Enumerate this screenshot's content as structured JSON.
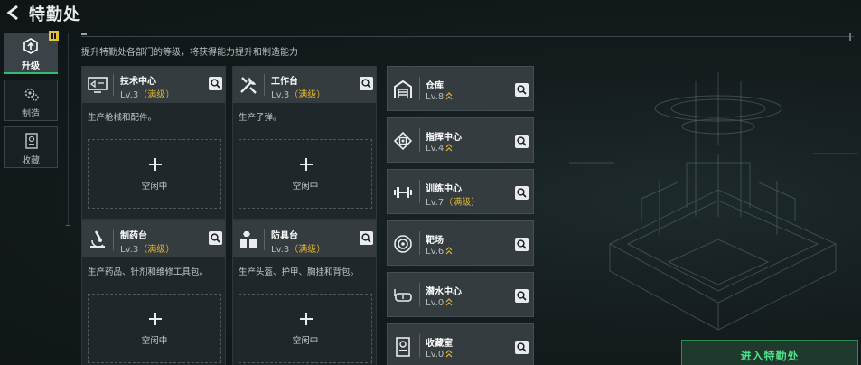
{
  "header": {
    "title": "特勤处"
  },
  "subtitle": "提升特勤处各部门的等级，将获得能力提升和制造能力",
  "sidebar": [
    {
      "label": "升级",
      "icon": "upgrade-icon",
      "active": true
    },
    {
      "label": "制造",
      "icon": "gear-icon",
      "active": false
    },
    {
      "label": "收藏",
      "icon": "collection-icon",
      "active": false
    }
  ],
  "cards": [
    {
      "name": "技术中心",
      "level": "Lv.3",
      "max": "（满级）",
      "desc": "生产枪械和配件。",
      "slot": "空闲中",
      "icon": "monitor-icon"
    },
    {
      "name": "工作台",
      "level": "Lv.3",
      "max": "（满级）",
      "desc": "生产子弹。",
      "slot": "空闲中",
      "icon": "tools-icon"
    },
    {
      "name": "制药台",
      "level": "Lv.3",
      "max": "（满级）",
      "desc": "生产药品、针剂和维修工具包。",
      "slot": "空闲中",
      "icon": "microscope-icon"
    },
    {
      "name": "防具台",
      "level": "Lv.3",
      "max": "（满级）",
      "desc": "生产头盔、护甲、胸挂和背包。",
      "slot": "空闲中",
      "icon": "armor-icon"
    }
  ],
  "facilities": [
    {
      "name": "仓库",
      "level": "Lv.8",
      "max": "",
      "icon": "warehouse-icon"
    },
    {
      "name": "指挥中心",
      "level": "Lv.4",
      "max": "",
      "icon": "chip-icon"
    },
    {
      "name": "训练中心",
      "level": "Lv.7",
      "max": "（满级）",
      "icon": "dumbbell-icon"
    },
    {
      "name": "靶场",
      "level": "Lv.6",
      "max": "",
      "icon": "target-icon"
    },
    {
      "name": "潜水中心",
      "level": "Lv.0",
      "max": "",
      "icon": "diving-goggles-icon"
    },
    {
      "name": "收藏室",
      "level": "Lv.0",
      "max": "",
      "icon": "collection-room-icon"
    }
  ],
  "enter_button": "进入特勤处",
  "colors": {
    "accent_green": "#2fbf6f",
    "max_level_gold": "#e5b42f",
    "notification_yellow": "#e2c237"
  }
}
